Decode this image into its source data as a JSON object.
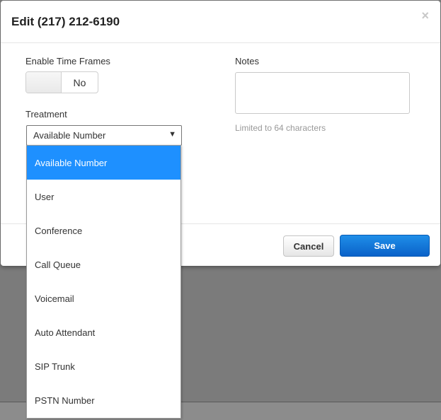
{
  "modal": {
    "title": "Edit (217) 212-6190",
    "close_glyph": "×"
  },
  "time_frames": {
    "label": "Enable Time Frames",
    "toggle_value": "No"
  },
  "treatment": {
    "label": "Treatment",
    "selected": "Available Number",
    "arrow_glyph": "▼",
    "options": [
      "Available Number",
      "User",
      "Conference",
      "Call Queue",
      "Voicemail",
      "Auto Attendant",
      "SIP Trunk",
      "PSTN Number"
    ]
  },
  "notes": {
    "label": "Notes",
    "value": "",
    "hint": "Limited to 64 characters"
  },
  "footer": {
    "cancel_label": "Cancel",
    "save_label": "Save"
  },
  "colors": {
    "accent": "#1e90ff",
    "save_button": "#0a62c9",
    "backdrop": "#7b7b7b"
  }
}
